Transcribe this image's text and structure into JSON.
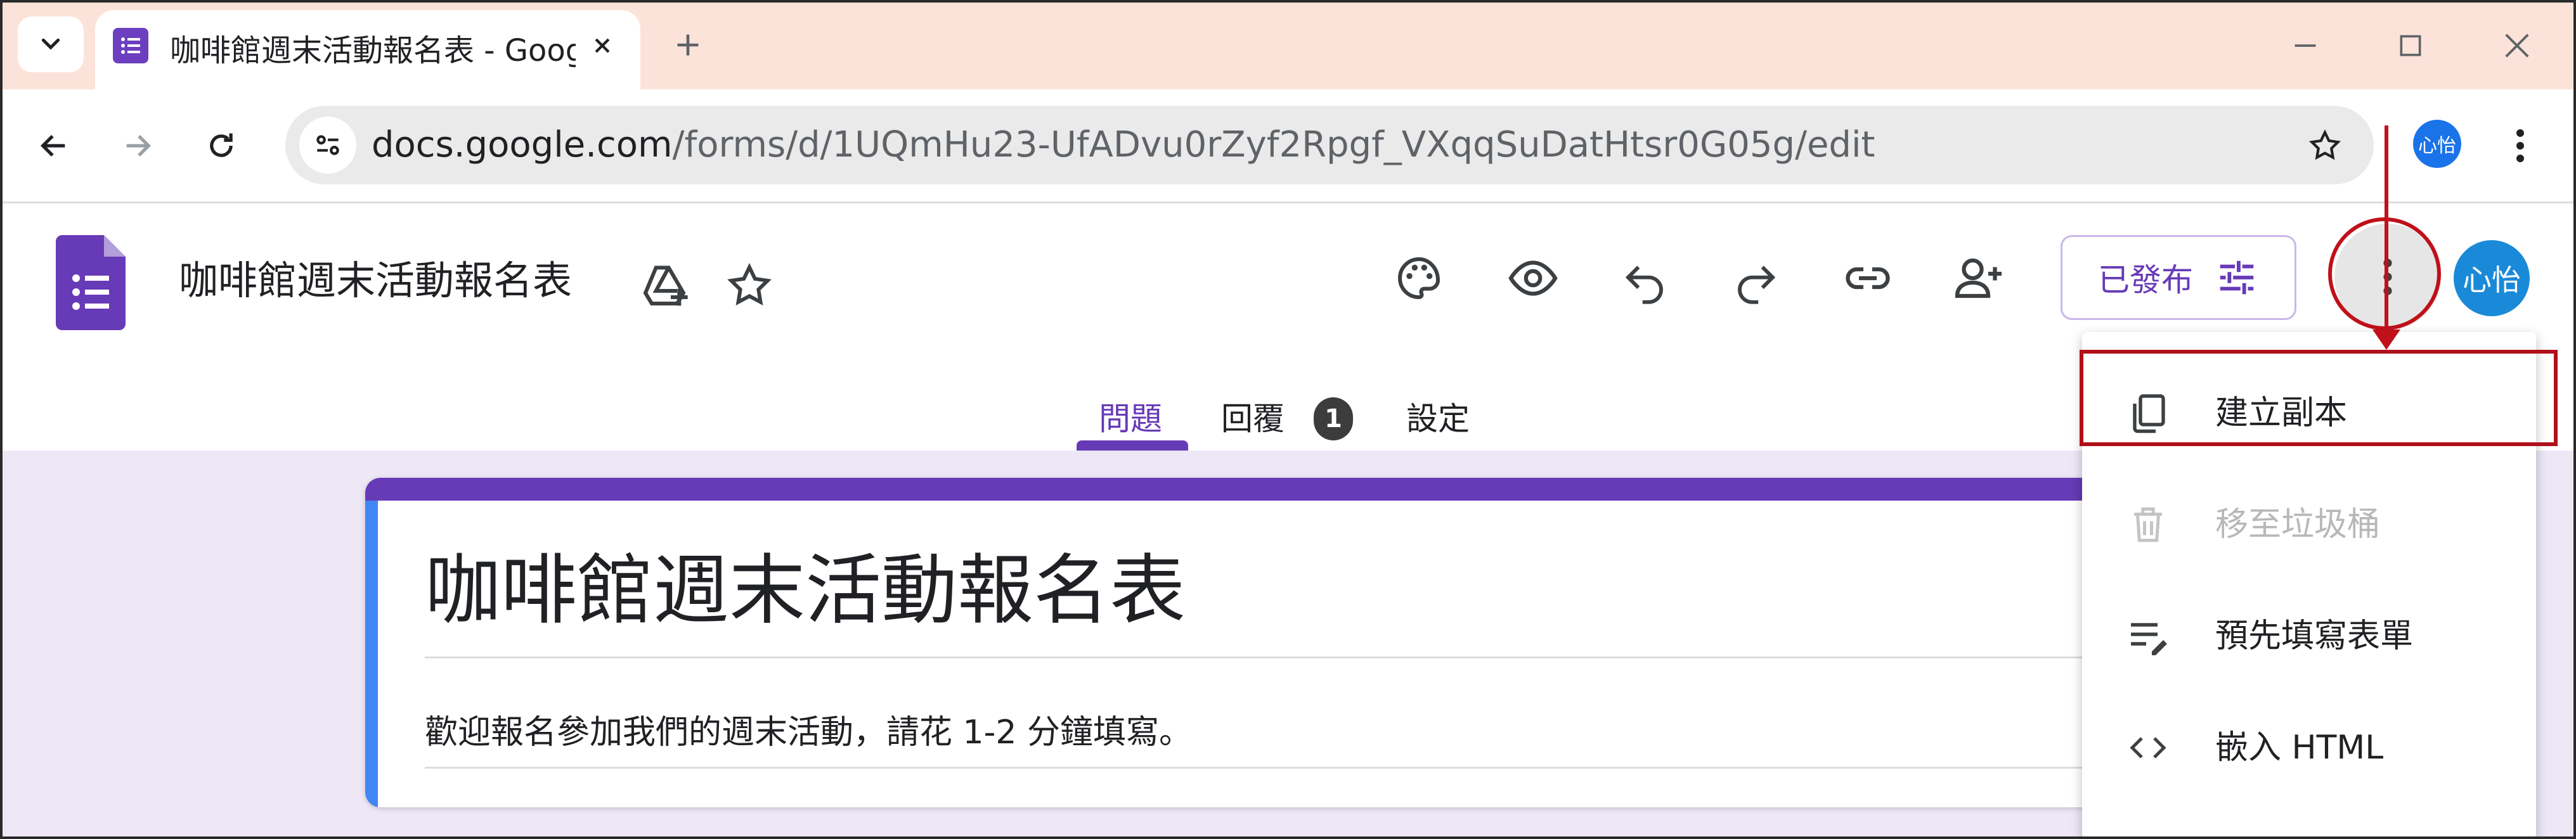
{
  "browser": {
    "tab_title": "咖啡館週末活動報名表 - Google Forms",
    "url_host": "docs.google.com",
    "url_path": "/forms/d/1UQmHu23-UfADvu0rZyf2Rpgf_VXqqSuDatHtsr0G05g/edit",
    "profile_label": "心怡"
  },
  "form_header": {
    "doc_title": "咖啡館週末活動報名表",
    "publish_label": "已發布",
    "avatar_label": "心怡"
  },
  "form_tabs": [
    {
      "label": "問題"
    },
    {
      "label": "回覆"
    },
    {
      "label": "設定"
    }
  ],
  "responses_count": "1",
  "form": {
    "title": "咖啡館週末活動報名表",
    "description": "歡迎報名參加我們的週末活動，請花 1-2 分鐘填寫。"
  },
  "more_menu": [
    {
      "label": "建立副本",
      "icon": "copy-icon",
      "enabled": true
    },
    {
      "label": "移至垃圾桶",
      "icon": "trash-icon",
      "enabled": false
    },
    {
      "label": "預先填寫表單",
      "icon": "prefill-icon",
      "enabled": true
    },
    {
      "label": "嵌入 HTML",
      "icon": "embed-code-icon",
      "enabled": true
    }
  ],
  "colors": {
    "accent": "#673ab7",
    "tabstrip": "#fce3d9",
    "canvas": "#ede7f6",
    "highlight": "#c0101a"
  }
}
